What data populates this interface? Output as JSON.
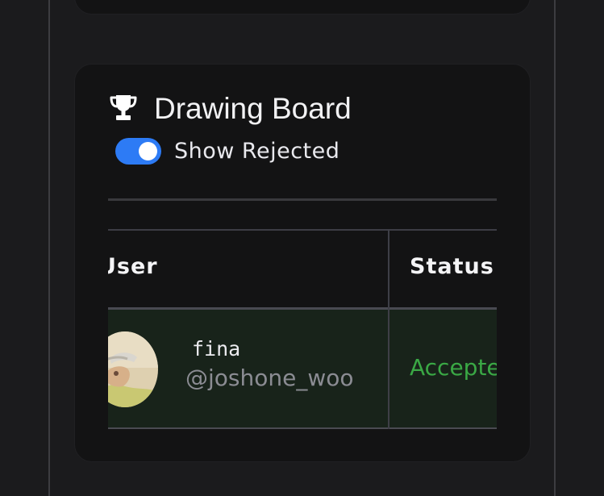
{
  "board": {
    "title": "Drawing Board",
    "icon": "trophy-icon",
    "toggle": {
      "label": "Show Rejected",
      "on": true,
      "accent": "#2d7bf5"
    }
  },
  "table": {
    "columns": [
      "User",
      "Status"
    ],
    "rows": [
      {
        "name": "fina",
        "handle": "@joshone_woo",
        "status": "Accepted",
        "status_color": "#3aa845"
      }
    ]
  }
}
